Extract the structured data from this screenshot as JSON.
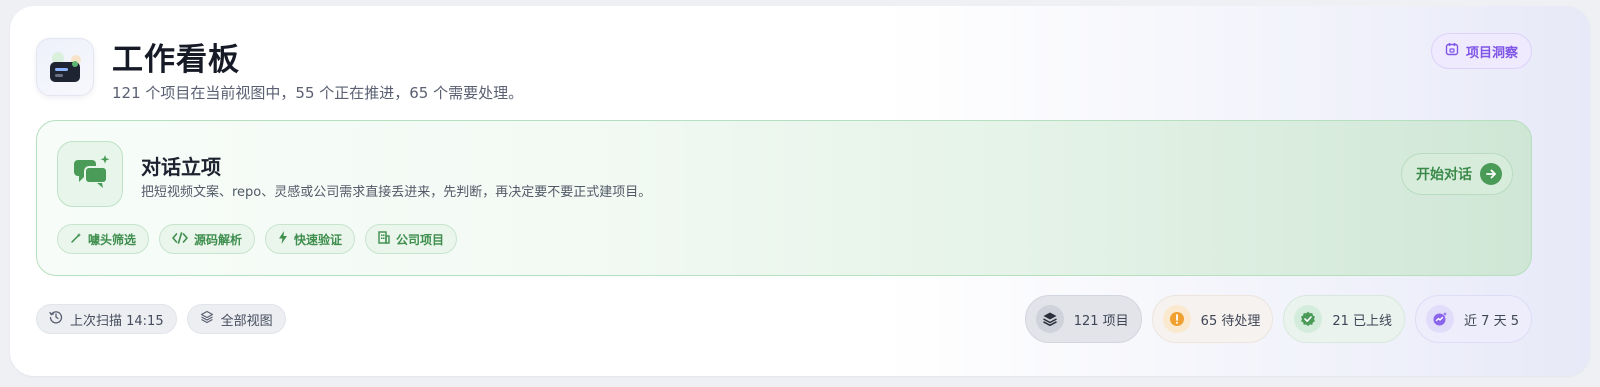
{
  "header": {
    "title": "工作看板",
    "subtitle": "121 个项目在当前视图中，55 个正在推进，65 个需要处理。",
    "insight_button": "项目洞察"
  },
  "intake": {
    "title": "对话立项",
    "description": "把短视频文案、repo、灵感或公司需求直接丢进来，先判断，再决定要不要正式建项目。",
    "start_button": "开始对话",
    "chips": [
      {
        "label": "噱头筛选",
        "icon": "magic-wand-icon"
      },
      {
        "label": "源码解析",
        "icon": "code-icon"
      },
      {
        "label": "快速验证",
        "icon": "lightning-icon"
      },
      {
        "label": "公司项目",
        "icon": "building-icon"
      }
    ]
  },
  "meta": {
    "last_scan": "上次扫描 14:15",
    "view": "全部视图"
  },
  "stats": {
    "projects": "121 项目",
    "pending": "65 待处理",
    "online": "21 已上线",
    "recent": "近 7 天 5"
  },
  "colors": {
    "accent_green": "#4a9b58",
    "accent_purple": "#8056e6",
    "warning_orange": "#f0a030"
  }
}
